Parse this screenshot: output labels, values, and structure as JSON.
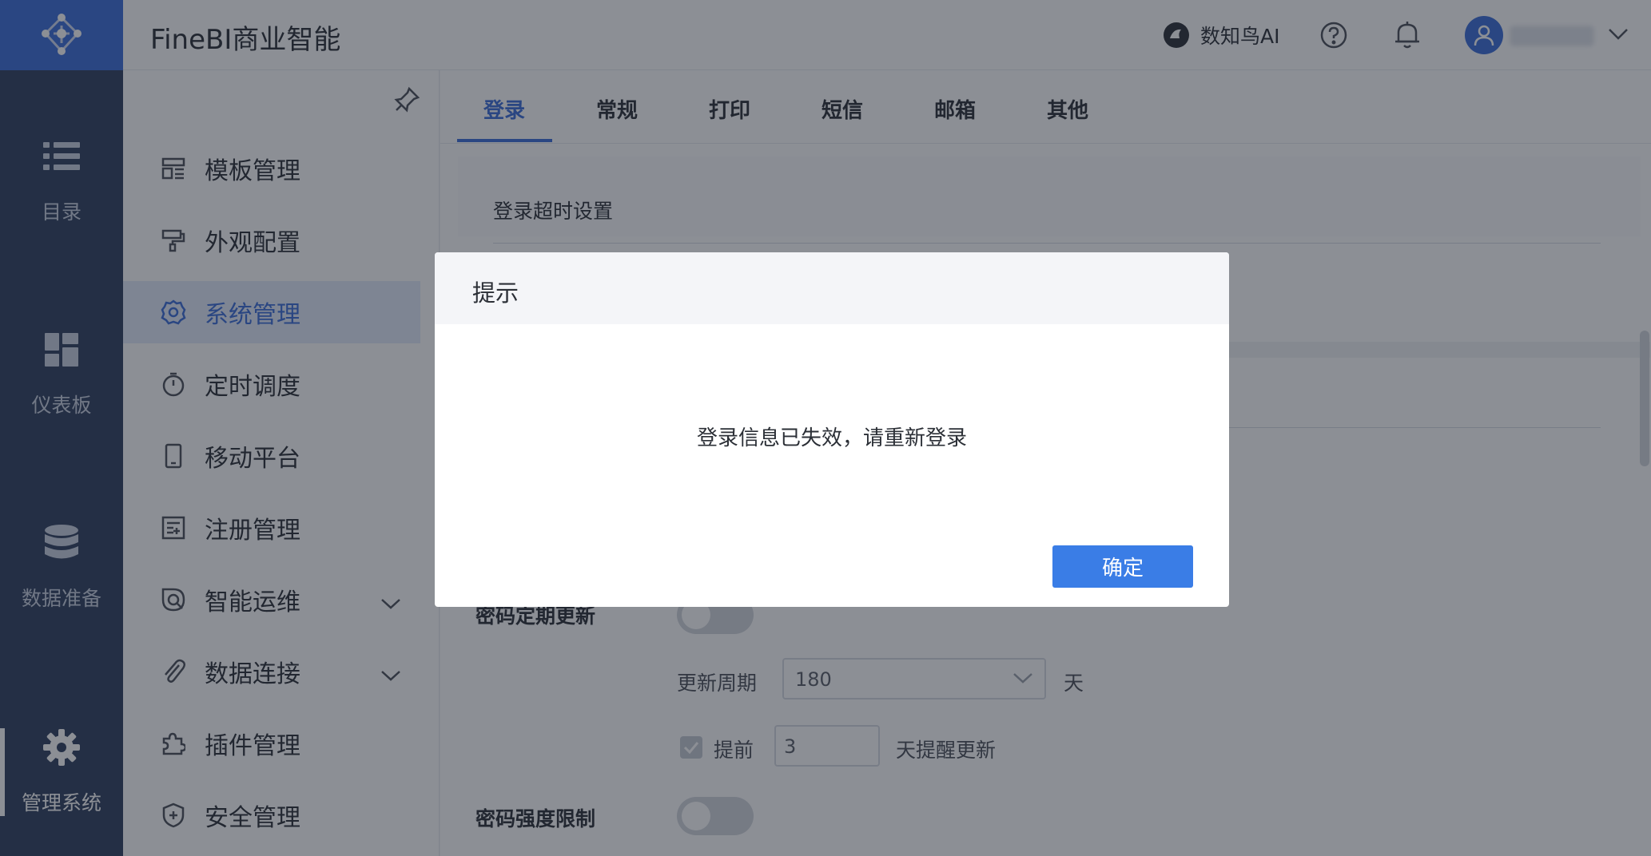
{
  "app": {
    "title": "FineBI商业智能"
  },
  "rail": {
    "items": [
      {
        "label": "目录",
        "icon": "list-icon"
      },
      {
        "label": "仪表板",
        "icon": "dashboard-icon"
      },
      {
        "label": "数据准备",
        "icon": "database-icon"
      },
      {
        "label": "管理系统",
        "icon": "gear-icon",
        "active": true
      }
    ]
  },
  "header": {
    "ai_label": "数知鸟AI",
    "user_name": "(blurred)"
  },
  "menu": {
    "items": [
      {
        "label": "模板管理",
        "icon": "template-icon"
      },
      {
        "label": "外观配置",
        "icon": "paint-roller-icon"
      },
      {
        "label": "系统管理",
        "icon": "settings-icon",
        "active": true
      },
      {
        "label": "定时调度",
        "icon": "timer-icon"
      },
      {
        "label": "移动平台",
        "icon": "mobile-icon"
      },
      {
        "label": "注册管理",
        "icon": "register-icon"
      },
      {
        "label": "智能运维",
        "icon": "ops-icon",
        "expandable": true
      },
      {
        "label": "数据连接",
        "icon": "paperclip-icon",
        "expandable": true
      },
      {
        "label": "插件管理",
        "icon": "puzzle-icon"
      },
      {
        "label": "安全管理",
        "icon": "shield-icon"
      }
    ]
  },
  "tabs": [
    {
      "label": "登录",
      "active": true
    },
    {
      "label": "常规"
    },
    {
      "label": "打印"
    },
    {
      "label": "短信"
    },
    {
      "label": "邮箱"
    },
    {
      "label": "其他"
    }
  ],
  "content": {
    "section_title": "登录超时设置",
    "pwd_update_label": "密码定期更新",
    "update_period_label": "更新周期",
    "update_period_value": "180",
    "update_period_unit": "天",
    "advance_label": "提前",
    "advance_value": "3",
    "advance_suffix": "天提醒更新",
    "pwd_strength_label": "密码强度限制"
  },
  "modal": {
    "title": "提示",
    "message": "登录信息已失效，请重新登录",
    "confirm_label": "确定"
  },
  "colors": {
    "accent": "#3a6cd8",
    "rail_bg": "#2f3f5e",
    "button": "#3a7de6"
  }
}
